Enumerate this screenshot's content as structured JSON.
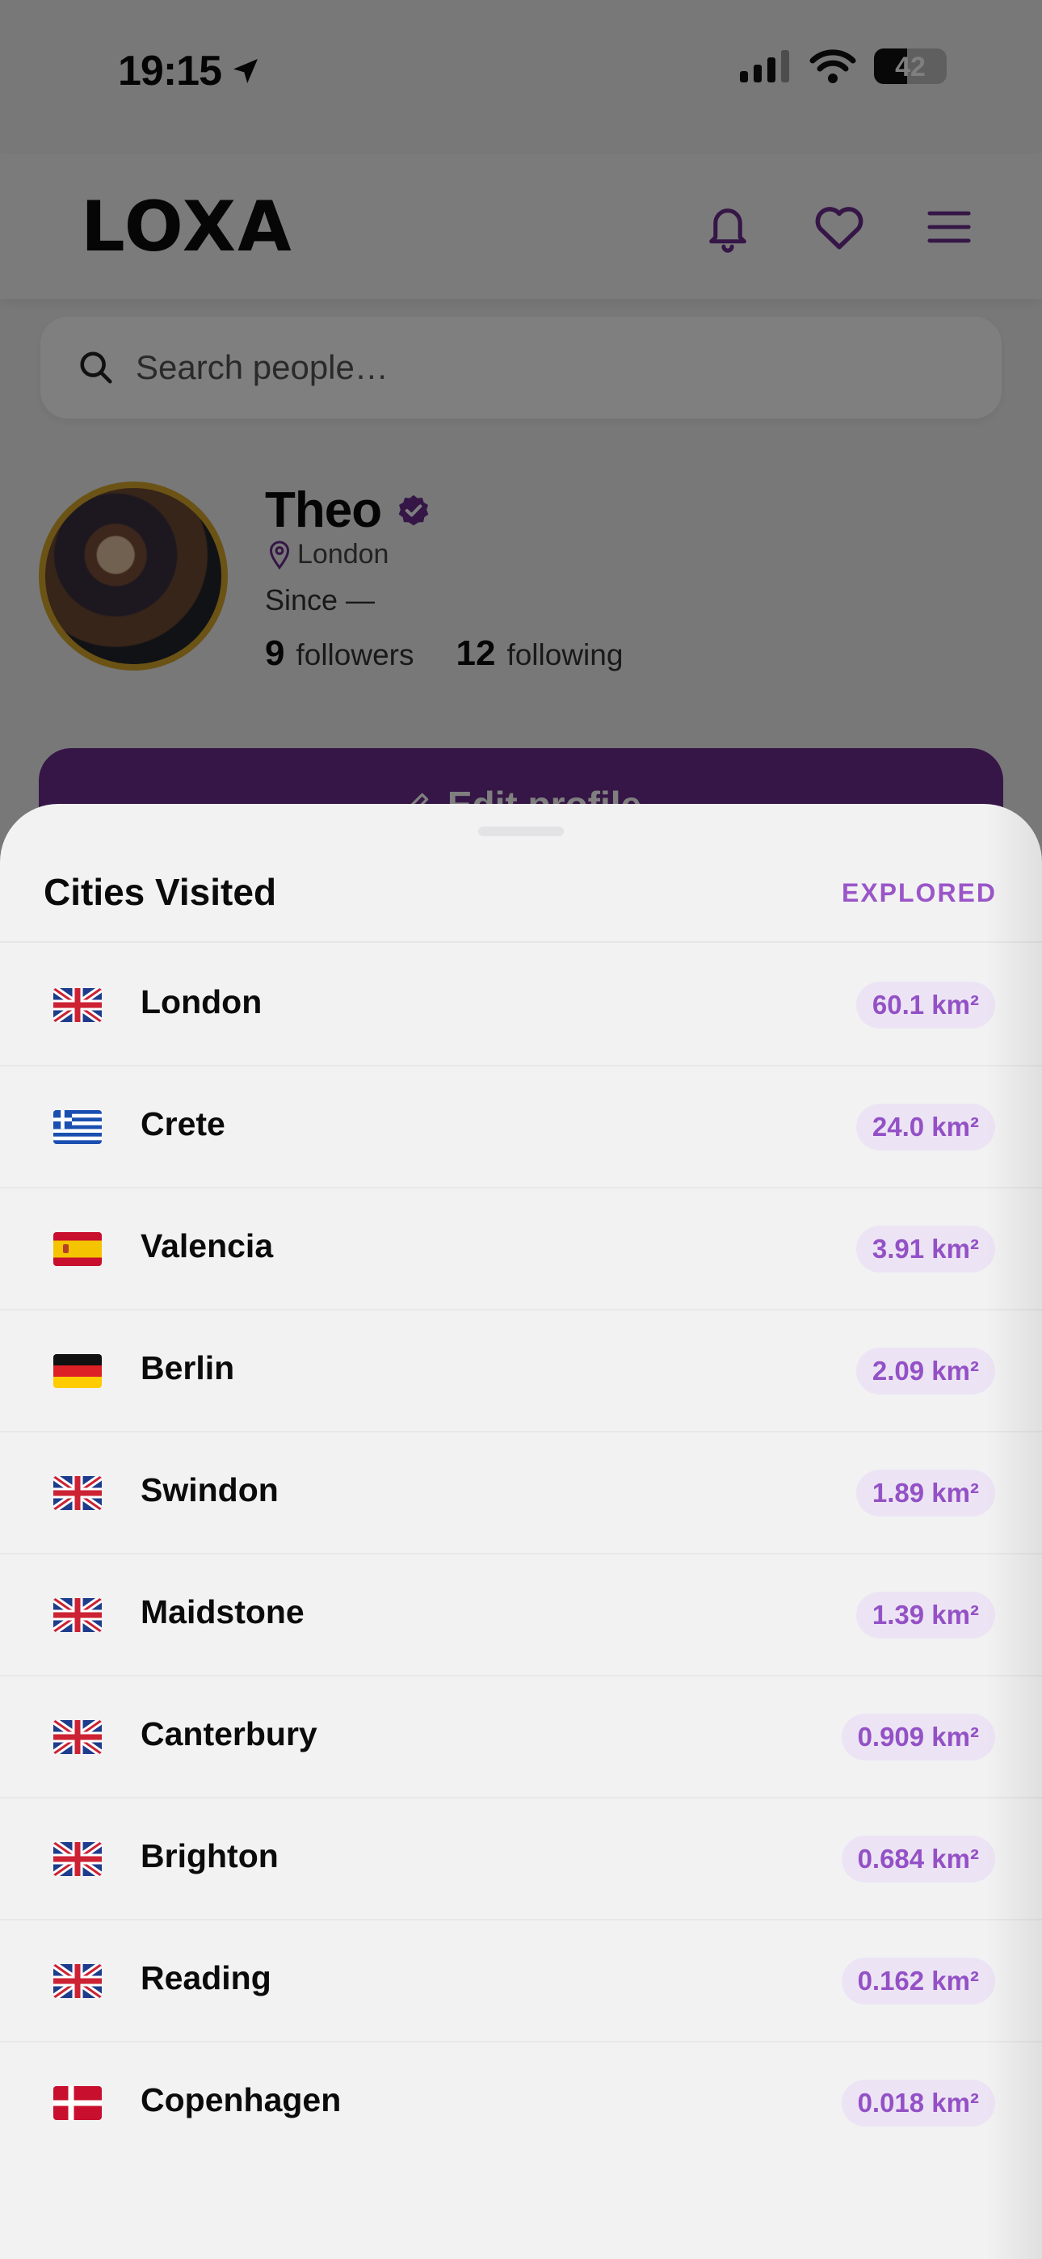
{
  "status_bar": {
    "time": "19:15",
    "battery": "42"
  },
  "app": {
    "logo": "LOXA"
  },
  "search": {
    "placeholder": "Search people…"
  },
  "profile": {
    "name": "Theo",
    "location": "London",
    "since": "Since —",
    "followers_count": "9",
    "followers_label": "followers",
    "following_count": "12",
    "following_label": "following"
  },
  "edit_profile": {
    "label": "Edit profile"
  },
  "colors": {
    "accent": "#9451c6",
    "brand": "#6a2d8c",
    "badge_bg": "#ece4f4",
    "avatar_ring": "#d7a62b"
  },
  "sheet": {
    "title": "Cities Visited",
    "tag": "EXPLORED",
    "cities": [
      {
        "name": "London",
        "area": "60.1 km²",
        "flag": "gb"
      },
      {
        "name": "Crete",
        "area": "24.0 km²",
        "flag": "gr"
      },
      {
        "name": "Valencia",
        "area": "3.91 km²",
        "flag": "es"
      },
      {
        "name": "Berlin",
        "area": "2.09 km²",
        "flag": "de"
      },
      {
        "name": "Swindon",
        "area": "1.89 km²",
        "flag": "gb"
      },
      {
        "name": "Maidstone",
        "area": "1.39 km²",
        "flag": "gb"
      },
      {
        "name": "Canterbury",
        "area": "0.909 km²",
        "flag": "gb"
      },
      {
        "name": "Brighton",
        "area": "0.684 km²",
        "flag": "gb"
      },
      {
        "name": "Reading",
        "area": "0.162 km²",
        "flag": "gb"
      },
      {
        "name": "Copenhagen",
        "area": "0.018 km²",
        "flag": "dk"
      }
    ]
  }
}
